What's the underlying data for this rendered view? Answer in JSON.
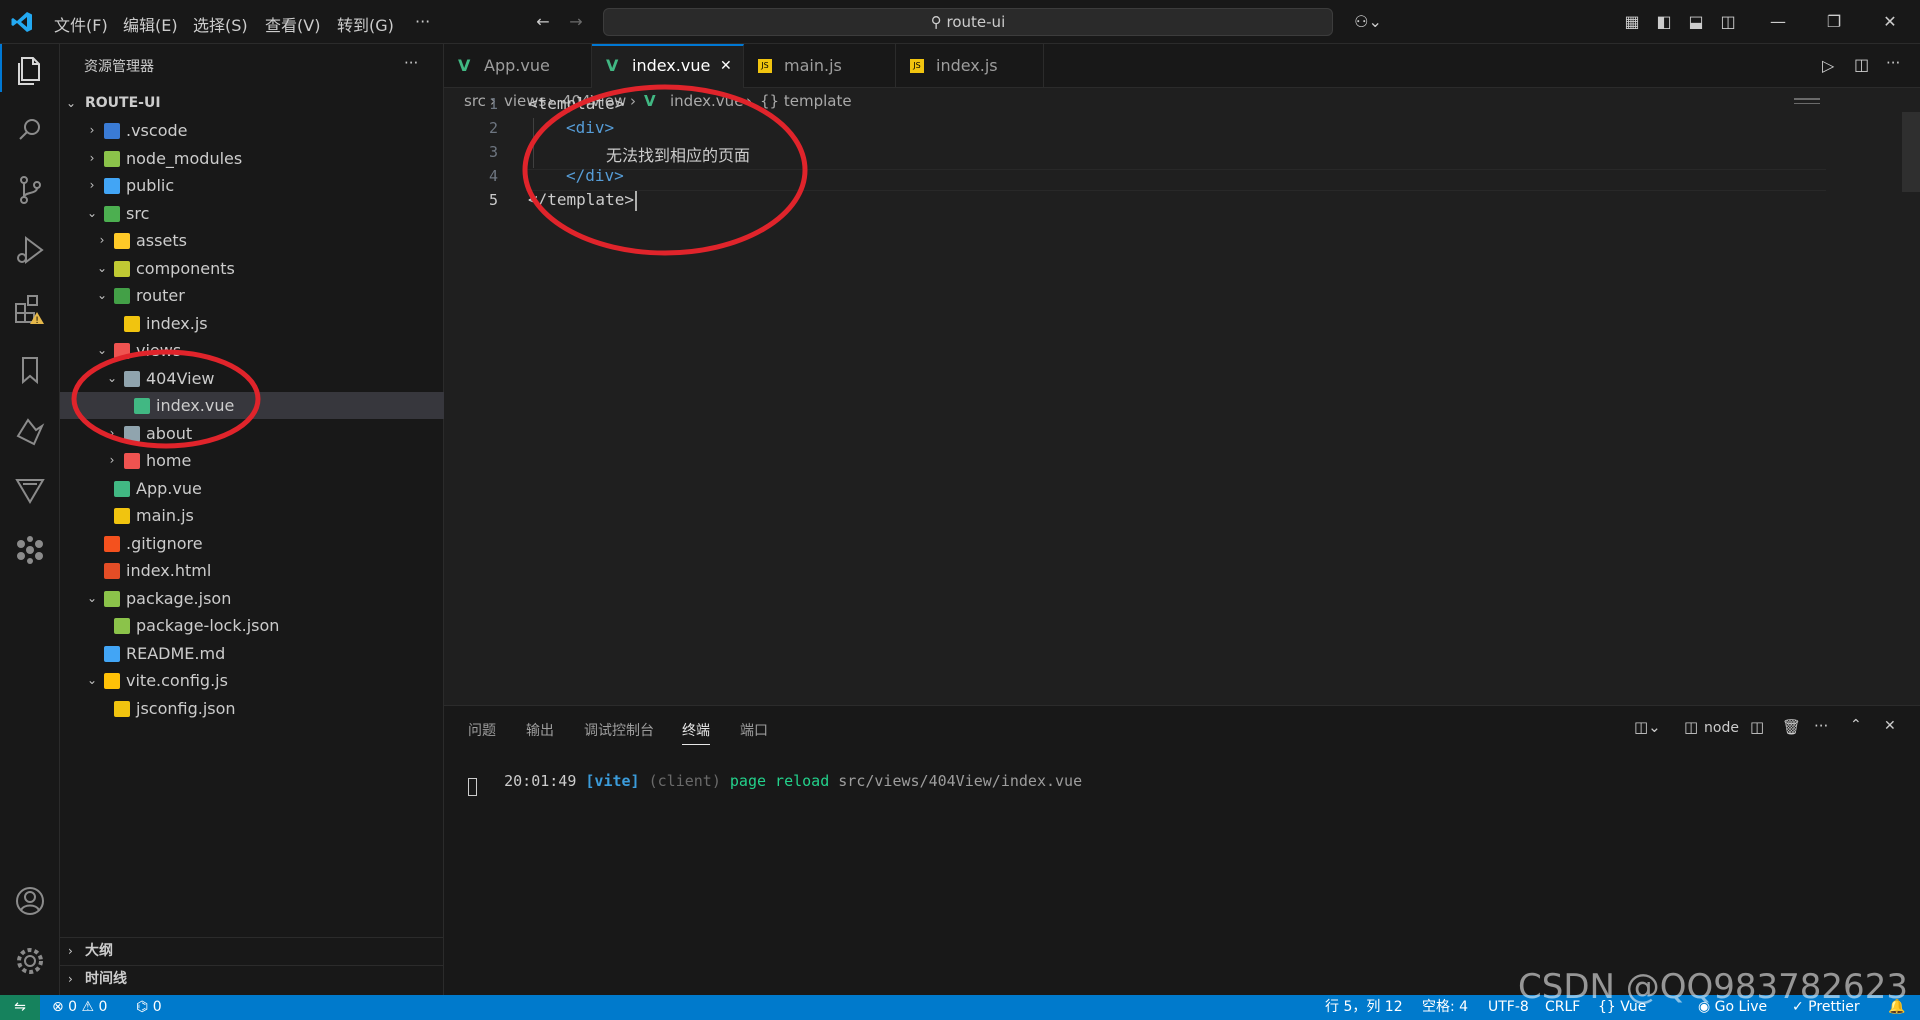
{
  "menu": [
    "文件(F)",
    "编辑(E)",
    "选择(S)",
    "查看(V)",
    "转到(G)",
    "···"
  ],
  "search": {
    "label": "route-ui"
  },
  "sidebar": {
    "title": "资源管理器",
    "more": "···",
    "root": "ROUTE-UI",
    "tree": [
      {
        "label": ".vscode",
        "depth": 1,
        "chev": "›",
        "color": "#3a7bd5"
      },
      {
        "label": "node_modules",
        "depth": 1,
        "chev": "›",
        "color": "#8bc34a"
      },
      {
        "label": "public",
        "depth": 1,
        "chev": "›",
        "color": "#42a5f5"
      },
      {
        "label": "src",
        "depth": 1,
        "chev": "⌄",
        "color": "#4caf50"
      },
      {
        "label": "assets",
        "depth": 2,
        "chev": "›",
        "color": "#ffca28"
      },
      {
        "label": "components",
        "depth": 2,
        "chev": "⌄",
        "color": "#c0ca33"
      },
      {
        "label": "router",
        "depth": 2,
        "chev": "⌄",
        "color": "#43a047"
      },
      {
        "label": "index.js",
        "depth": 3,
        "chev": "",
        "color": "#f1c40f"
      },
      {
        "label": "views",
        "depth": 2,
        "chev": "⌄",
        "color": "#ef5350"
      },
      {
        "label": "404View",
        "depth": 3,
        "chev": "⌄",
        "color": "#90a4ae"
      },
      {
        "label": "index.vue",
        "depth": 4,
        "chev": "",
        "color": "#41b883"
      },
      {
        "label": "about",
        "depth": 3,
        "chev": "›",
        "color": "#90a4ae"
      },
      {
        "label": "home",
        "depth": 3,
        "chev": "›",
        "color": "#ef5350"
      },
      {
        "label": "App.vue",
        "depth": 2,
        "chev": "",
        "color": "#41b883"
      },
      {
        "label": "main.js",
        "depth": 2,
        "chev": "",
        "color": "#f1c40f"
      },
      {
        "label": ".gitignore",
        "depth": 1,
        "chev": "",
        "color": "#f4511e"
      },
      {
        "label": "index.html",
        "depth": 1,
        "chev": "",
        "color": "#e44d26"
      },
      {
        "label": "package.json",
        "depth": 1,
        "chev": "⌄",
        "color": "#8bc34a"
      },
      {
        "label": "package-lock.json",
        "depth": 2,
        "chev": "",
        "color": "#8bc34a"
      },
      {
        "label": "README.md",
        "depth": 1,
        "chev": "",
        "color": "#42a5f5"
      },
      {
        "label": "vite.config.js",
        "depth": 1,
        "chev": "⌄",
        "color": "#ffc107"
      },
      {
        "label": "jsconfig.json",
        "depth": 2,
        "chev": "",
        "color": "#f1c40f"
      }
    ],
    "outline": "大纲",
    "timeline": "时间线"
  },
  "tabs": [
    {
      "label": "App.vue",
      "icon": "V",
      "color": "#41b883"
    },
    {
      "label": "index.vue",
      "icon": "V",
      "color": "#41b883",
      "close": "✕"
    },
    {
      "label": "main.js",
      "icon": "JS",
      "color": "#f1c40f"
    },
    {
      "label": "index.js",
      "icon": "JS",
      "color": "#f1c40f"
    }
  ],
  "breadcrumb": [
    "src",
    "views",
    "404View",
    "index.vue",
    "{} template"
  ],
  "code": {
    "line_numbers": [
      "1",
      "2",
      "3",
      "4",
      "5"
    ],
    "l1": "<template>",
    "l2": "<div>",
    "l3": "无法找到相应的页面",
    "l4": "</div>",
    "l5": "</template>"
  },
  "panel": {
    "tabs": [
      "问题",
      "输出",
      "调试控制台",
      "终端",
      "端口"
    ],
    "node": "node",
    "terminal": {
      "time": "20:01:49",
      "vite": "[vite]",
      "client": "(client)",
      "action": "page reload",
      "path": "src/views/404View/index.vue"
    }
  },
  "status": {
    "errors": "⊗ 0 ⚠ 0",
    "ports": "0",
    "position": "行 5，列 12",
    "spaces": "空格: 4",
    "encoding": "UTF-8",
    "eol": "CRLF",
    "language": "{} Vue",
    "golive": "Go Live",
    "prettier": "✓ Prettier"
  },
  "watermark": "CSDN @QQ983782623",
  "colors": {
    "accent": "#007acc",
    "annotation": "#e0242b"
  }
}
